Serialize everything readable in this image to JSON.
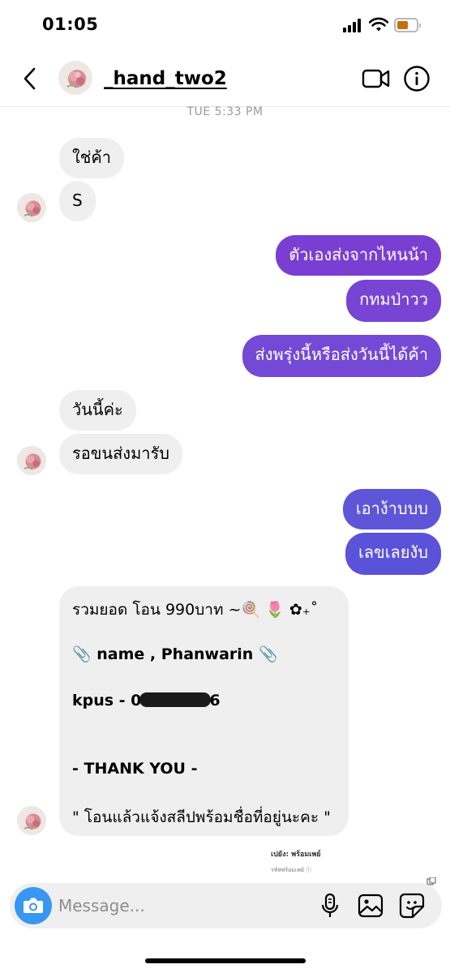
{
  "status_bar": {
    "time": "01:05",
    "battery_color": "#c4700f"
  },
  "header": {
    "username": "_hand_two2",
    "back_icon": "chevron-left-icon",
    "video_icon": "video-camera-icon",
    "info_icon": "info-icon"
  },
  "timestamp": "TUE 5:33 PM",
  "colors": {
    "incoming_bubble": "#efefef",
    "outgoing_purple": "#7b3fd1",
    "outgoing_indigo": "#5b4fd8",
    "camera_button": "#3897f0"
  },
  "messages": [
    {
      "direction": "incoming",
      "text": "ใช่ค้า"
    },
    {
      "direction": "incoming",
      "text": "S"
    },
    {
      "direction": "outgoing",
      "text": "ตัวเองส่งจากไหนน้า"
    },
    {
      "direction": "outgoing",
      "text": "กทมป่าวว"
    },
    {
      "direction": "outgoing",
      "text": "ส่งพรุ่งนี้หรือส่งวันนี้ได้ค้า"
    },
    {
      "direction": "incoming",
      "text": "วันนี้ค่ะ"
    },
    {
      "direction": "incoming",
      "text": "รอขนส่งมารับ"
    },
    {
      "direction": "outgoing",
      "text": "เอาง้าบบบ"
    },
    {
      "direction": "outgoing",
      "text": "เลขเลยงับ"
    }
  ],
  "bank_card": {
    "total_line": "รวมยอด โอน 990บาท ~🍭 🌷 ✿₊˚",
    "name_line": "📎 name , Phanwarin 📎",
    "account_prefix": "kpus - 0",
    "account_suffix": "6",
    "thanks": "- THANK YOU -",
    "note": "\" โอนแล้วแจ้งสลีปพร้อมชื่อที่อยู่นะคะ \""
  },
  "shared_preview": {
    "line1": "เปยัง: พร้อมเพย์",
    "line2": "รหัสพร้อมเพย์ ⓘ"
  },
  "composer": {
    "placeholder": "Message...",
    "camera_icon": "camera-icon",
    "mic_icon": "microphone-icon",
    "gallery_icon": "image-gallery-icon",
    "sticker_icon": "sticker-icon"
  }
}
